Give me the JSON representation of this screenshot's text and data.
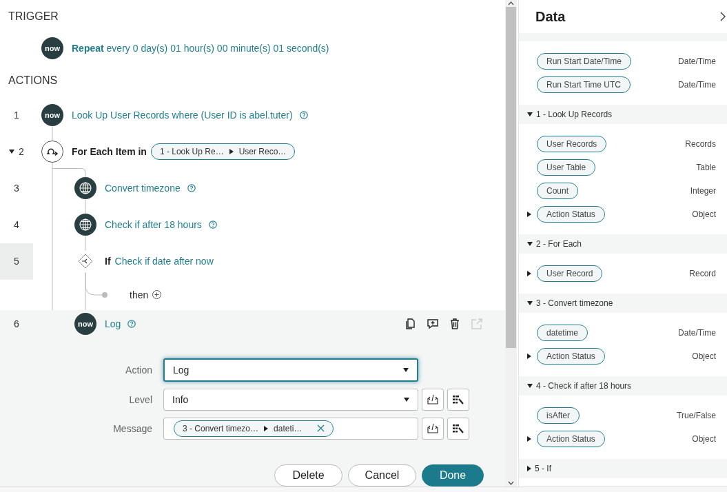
{
  "trigger": {
    "heading": "TRIGGER",
    "logo_text": "now",
    "title": "**Repeat** every 0 day(s) 01 hour(s) 00 minute(s) 01 second(s)"
  },
  "actions": {
    "heading": "ACTIONS",
    "steps": [
      {
        "number": "1",
        "kind": "now",
        "logo_text": "now",
        "title": "Look Up User Records where (User ID is abel.tuter)",
        "help": true,
        "selected": false
      },
      {
        "number": "2",
        "kind": "loop",
        "keyword": "For Each Item in",
        "pill": [
          "1 - Look Up Re…",
          "User Reco…"
        ],
        "expanded": true,
        "selected": false,
        "children": [
          {
            "number": "3",
            "kind": "globe",
            "title": "Convert timezone",
            "help": true,
            "selected": false
          },
          {
            "number": "4",
            "kind": "globe",
            "title": "Check if after 18 hours",
            "help": true,
            "selected": false
          },
          {
            "number": "5",
            "kind": "branch",
            "keyword": "If",
            "title": "Check if date after now",
            "selected": false,
            "hovered": true,
            "children": [
              {
                "kind": "then",
                "label": "then"
              }
            ]
          },
          {
            "number": "6",
            "kind": "now",
            "logo_text": "now",
            "title": "Log",
            "help": true,
            "selected": true,
            "tools": [
              {
                "kind": "copy",
                "disabled": false
              },
              {
                "kind": "comment",
                "disabled": false
              },
              {
                "kind": "delete",
                "disabled": false
              },
              {
                "kind": "open",
                "disabled": true
              }
            ]
          }
        ]
      }
    ]
  },
  "form": {
    "fields": [
      {
        "label": "Action",
        "kind": "select",
        "value": "Log",
        "focused": true,
        "tools": false
      },
      {
        "label": "Level",
        "kind": "select",
        "value": "Info",
        "focused": false,
        "tools": true
      },
      {
        "label": "Message",
        "kind": "pill",
        "pill": [
          "3 - Convert timezo…",
          "dateti…"
        ],
        "tools": true
      }
    ],
    "buttons": [
      {
        "label": "Delete",
        "primary": false
      },
      {
        "label": "Cancel",
        "primary": false
      },
      {
        "label": "Done",
        "primary": true
      }
    ]
  },
  "data_panel": {
    "title": "Data",
    "sections": [
      {
        "items": [
          {
            "name": "Run Start Date/Time",
            "type": "Date/Time",
            "expandable": false
          },
          {
            "name": "Run Start Time UTC",
            "type": "Date/Time",
            "expandable": false
          }
        ]
      },
      {
        "title": "1 - Look Up Records",
        "expanded": true,
        "items": [
          {
            "name": "User Records",
            "type": "Records",
            "expandable": false
          },
          {
            "name": "User Table",
            "type": "Table",
            "expandable": false
          },
          {
            "name": "Count",
            "type": "Integer",
            "expandable": false
          },
          {
            "name": "Action Status",
            "type": "Object",
            "expandable": true
          }
        ]
      },
      {
        "title": "2 - For Each",
        "expanded": true,
        "items": [
          {
            "name": "User Record",
            "type": "Record",
            "expandable": true
          }
        ]
      },
      {
        "title": "3 - Convert timezone",
        "expanded": true,
        "items": [
          {
            "name": "datetime",
            "type": "Date/Time",
            "expandable": false
          },
          {
            "name": "Action Status",
            "type": "Object",
            "expandable": true
          }
        ]
      },
      {
        "title": "4 - Check if after 18 hours",
        "expanded": true,
        "items": [
          {
            "name": "isAfter",
            "type": "True/False",
            "expandable": false
          },
          {
            "name": "Action Status",
            "type": "Object",
            "expandable": true
          }
        ]
      },
      {
        "title": "5 - If",
        "expanded": false
      }
    ]
  }
}
